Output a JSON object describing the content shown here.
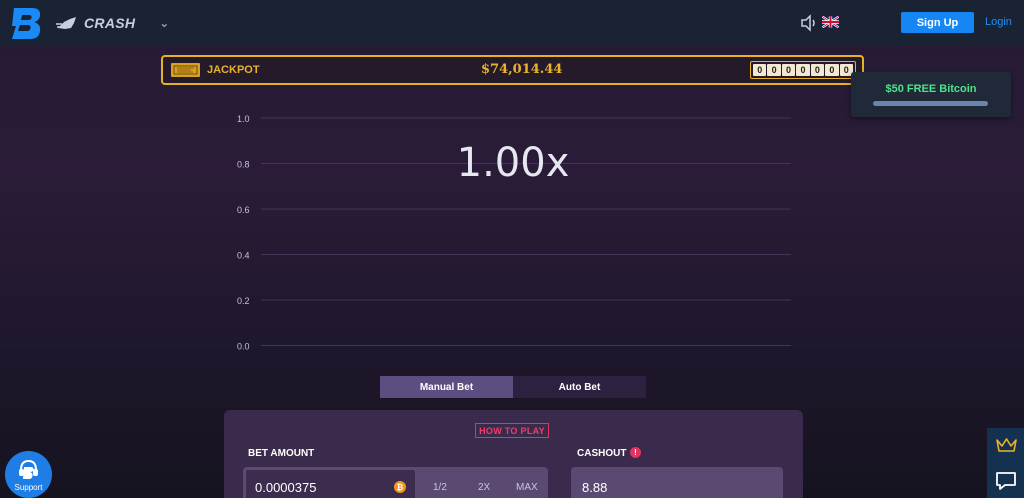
{
  "header": {
    "game_name": "CRASH",
    "signup_label": "Sign Up",
    "login_label": "Login"
  },
  "jackpot": {
    "label": "JACKPOT",
    "amount": "$74,014.44",
    "digits": [
      "0",
      "0",
      "0",
      "0",
      "0",
      "0",
      "0"
    ]
  },
  "promo": {
    "label": "$50 FREE Bitcoin"
  },
  "chart": {
    "multiplier": "1.00x",
    "y_ticks": [
      "1.0",
      "0.8",
      "0.6",
      "0.4",
      "0.2",
      "0.0"
    ]
  },
  "tabs": [
    {
      "label": "Manual Bet",
      "active": true
    },
    {
      "label": "Auto Bet",
      "active": false
    }
  ],
  "bet_panel": {
    "how_to_play": "HOW TO PLAY",
    "bet_amount_label": "BET AMOUNT",
    "bet_amount_value": "0.0000375",
    "half_label": "1/2",
    "double_label": "2X",
    "max_label": "MAX",
    "cashout_label": "CASHOUT",
    "cashout_info": "!",
    "cashout_value": "8.88",
    "btc_symbol": "₿"
  },
  "support": {
    "label": "Support"
  },
  "colors": {
    "accent_blue": "#1686f5",
    "jackpot_gold": "#e9b42b",
    "promo_green": "#4ee28a",
    "danger_pink": "#e0355e",
    "bitcoin_orange": "#f7931a"
  }
}
